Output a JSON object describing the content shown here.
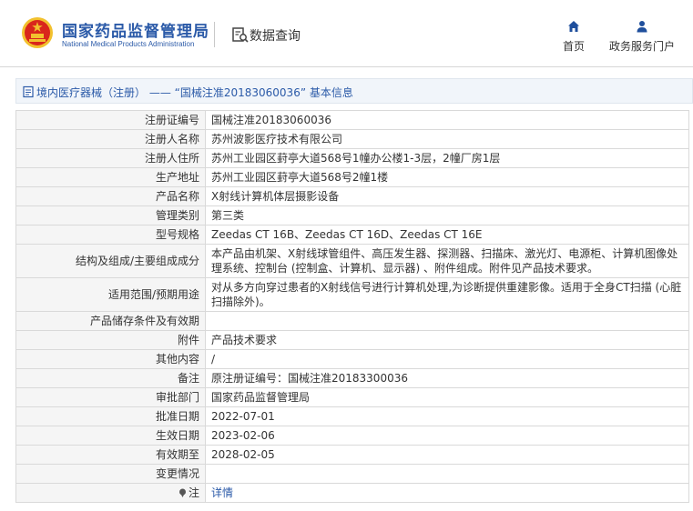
{
  "header": {
    "logo_cn": "国家药品监督管理局",
    "logo_en": "National Medical Products Administration",
    "db_title": "数据查询",
    "nav": [
      {
        "label": "首页",
        "icon": "home-icon"
      },
      {
        "label": "政务服务门户",
        "icon": "user-icon"
      }
    ]
  },
  "breadcrumb": {
    "text": "境内医疗器械（注册） —— “国械注准20183060036” 基本信息",
    "icon": "document-icon"
  },
  "rows": [
    {
      "label": "注册证编号",
      "value": "国械注准20183060036"
    },
    {
      "label": "注册人名称",
      "value": "苏州波影医疗技术有限公司"
    },
    {
      "label": "注册人住所",
      "value": "苏州工业园区葑亭大道568号1幢办公楼1-3层，2幢厂房1层"
    },
    {
      "label": "生产地址",
      "value": "苏州工业园区葑亭大道568号2幢1楼"
    },
    {
      "label": "产品名称",
      "value": "X射线计算机体层摄影设备"
    },
    {
      "label": "管理类别",
      "value": "第三类"
    },
    {
      "label": "型号规格",
      "value": "Zeedas CT 16B、Zeedas CT 16D、Zeedas CT 16E"
    },
    {
      "label": "结构及组成/主要组成成分",
      "value": "本产品由机架、X射线球管组件、高压发生器、探测器、扫描床、激光灯、电源柜、计算机图像处理系统、控制台 (控制盒、计算机、显示器) 、附件组成。附件见产品技术要求。"
    },
    {
      "label": "适用范围/预期用途",
      "value": "对从多方向穿过患者的X射线信号进行计算机处理,为诊断提供重建影像。适用于全身CT扫描 (心脏扫描除外)。"
    },
    {
      "label": "产品储存条件及有效期",
      "value": ""
    },
    {
      "label": "附件",
      "value": "产品技术要求"
    },
    {
      "label": "其他内容",
      "value": "/"
    },
    {
      "label": "备注",
      "value": "原注册证编号：国械注准20183300036"
    },
    {
      "label": "审批部门",
      "value": "国家药品监督管理局"
    },
    {
      "label": "批准日期",
      "value": "2022-07-01"
    },
    {
      "label": "生效日期",
      "value": "2023-02-06"
    },
    {
      "label": "有效期至",
      "value": "2028-02-05"
    },
    {
      "label": "变更情况",
      "value": ""
    }
  ],
  "note_row": {
    "label": "注",
    "value": "详情",
    "icon": "pin-icon"
  },
  "colors": {
    "brand_blue": "#2b5aa8",
    "label_bg": "#f5f5f5",
    "emblem_red": "#d9261c",
    "emblem_gold": "#f2c12e"
  }
}
